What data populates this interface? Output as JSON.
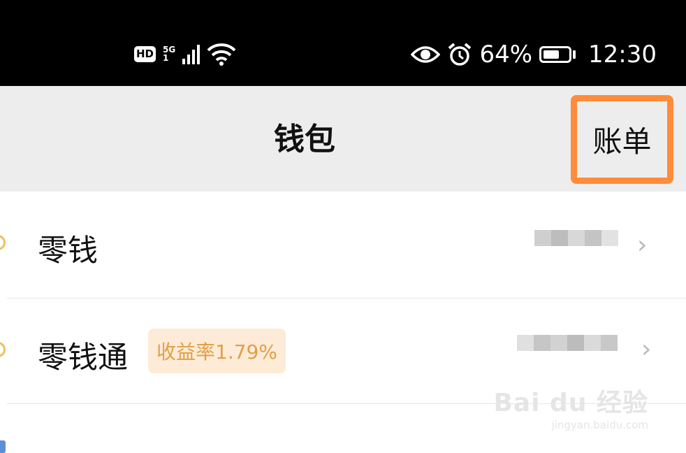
{
  "status_bar": {
    "hd_label": "HD",
    "network_label": "5G",
    "network_sub": "1",
    "battery_percent": "64%",
    "battery_level": 0.64,
    "time": "12:30",
    "icons": [
      "hd-icon",
      "signal-icon",
      "wifi-icon",
      "eye-icon",
      "alarm-icon",
      "battery-icon"
    ]
  },
  "nav": {
    "title": "钱包",
    "bill_label": "账单",
    "highlight_color": "#ff8c3a"
  },
  "rows": [
    {
      "label": "零钱",
      "amount": "",
      "blurred": true
    },
    {
      "label": "零钱通",
      "badge": "收益率1.79%",
      "amount": "",
      "blurred": true
    }
  ],
  "watermark": {
    "logo": "Bai du 经验",
    "url": "jingyan.baidu.com"
  },
  "colors": {
    "status_bar_bg": "#000000",
    "nav_bg": "#ededed",
    "badge_bg": "#fdebd7",
    "badge_text": "#e0a046"
  }
}
